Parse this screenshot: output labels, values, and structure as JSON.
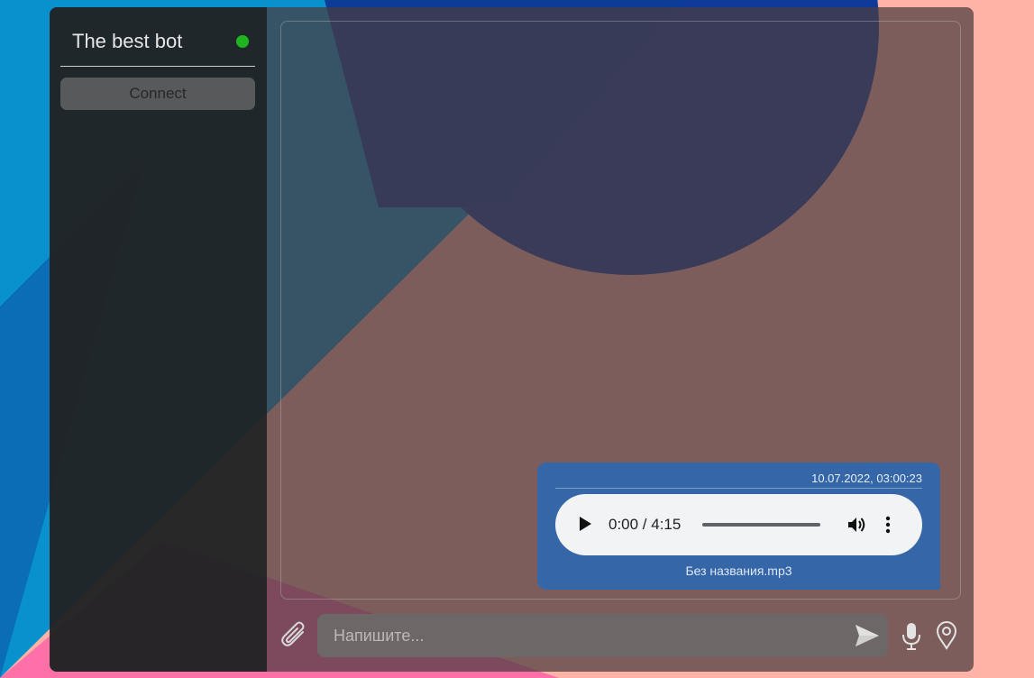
{
  "colors": {
    "status_online": "#1fb51f",
    "message_bubble": "#3466a8",
    "sidebar": "#212325"
  },
  "sidebar": {
    "bot_name": "The best bot",
    "status": "online",
    "connect_label": "Connect"
  },
  "chat": {
    "messages": [
      {
        "timestamp": "10.07.2022, 03:00:23",
        "audio": {
          "current_time": "0:00",
          "duration": "4:15",
          "time_display": "0:00 / 4:15",
          "progress": 0
        },
        "filename": "Без названия.mp3"
      }
    ]
  },
  "composer": {
    "placeholder": "Напишите...",
    "value": ""
  },
  "icons": [
    "paperclip-icon",
    "send-icon",
    "microphone-icon",
    "location-pin-icon",
    "play-icon",
    "volume-icon",
    "more-vert-icon"
  ]
}
